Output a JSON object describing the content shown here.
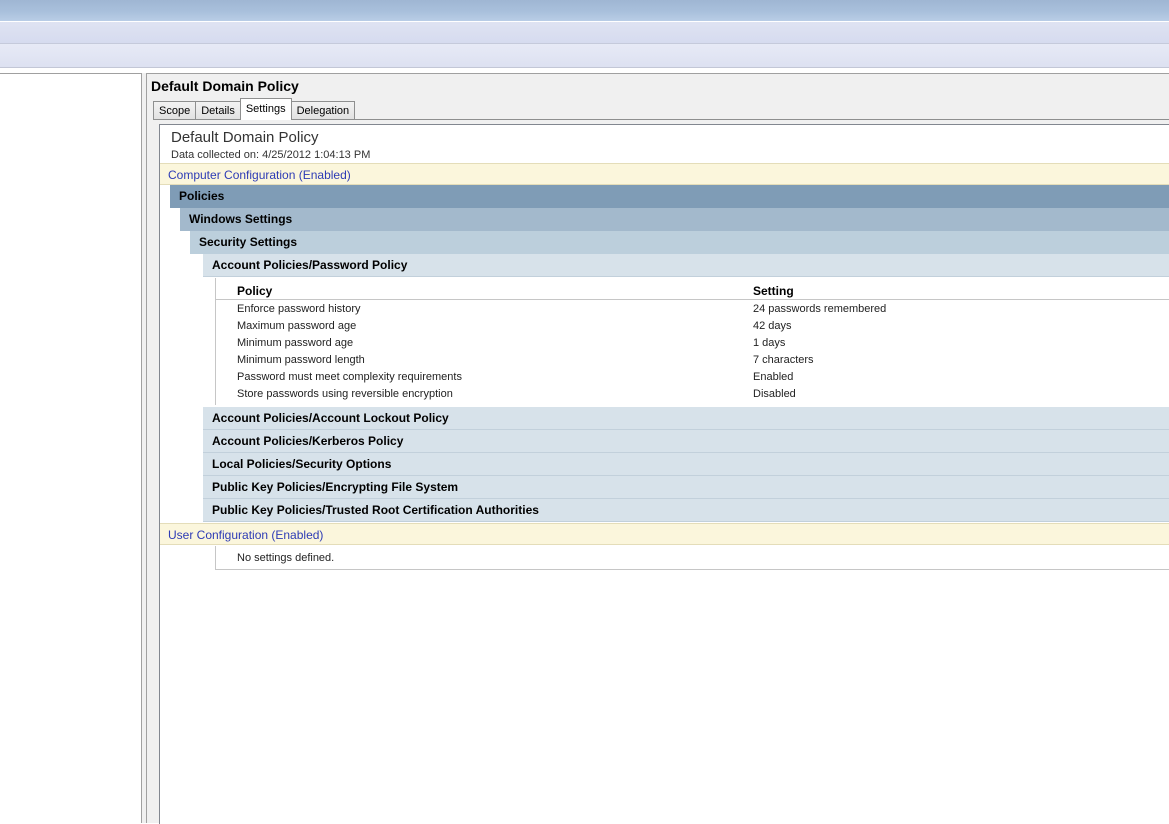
{
  "window": {
    "gpo_name": "Default Domain Policy"
  },
  "tabs": [
    {
      "label": "Scope",
      "active": false
    },
    {
      "label": "Details",
      "active": false
    },
    {
      "label": "Settings",
      "active": true
    },
    {
      "label": "Delegation",
      "active": false
    }
  ],
  "report": {
    "title": "Default Domain Policy",
    "collected": "Data collected on: 4/25/2012 1:04:13 PM",
    "computer_config": "Computer Configuration (Enabled)",
    "policies": "Policies",
    "windows_settings": "Windows Settings",
    "security_settings": "Security Settings",
    "password_policy": "Account Policies/Password Policy",
    "table": {
      "headers": [
        "Policy",
        "Setting"
      ],
      "rows": [
        [
          "Enforce password history",
          "24 passwords remembered"
        ],
        [
          "Maximum password age",
          "42 days"
        ],
        [
          "Minimum password age",
          "1 days"
        ],
        [
          "Minimum password length",
          "7 characters"
        ],
        [
          "Password must meet complexity requirements",
          "Enabled"
        ],
        [
          "Store passwords using reversible encryption",
          "Disabled"
        ]
      ]
    },
    "other_sections": [
      "Account Policies/Account Lockout Policy",
      "Account Policies/Kerberos Policy",
      "Local Policies/Security Options",
      "Public Key Policies/Encrypting File System",
      "Public Key Policies/Trusted Root Certification Authorities"
    ],
    "user_config": "User Configuration (Enabled)",
    "no_settings": "No settings defined."
  }
}
